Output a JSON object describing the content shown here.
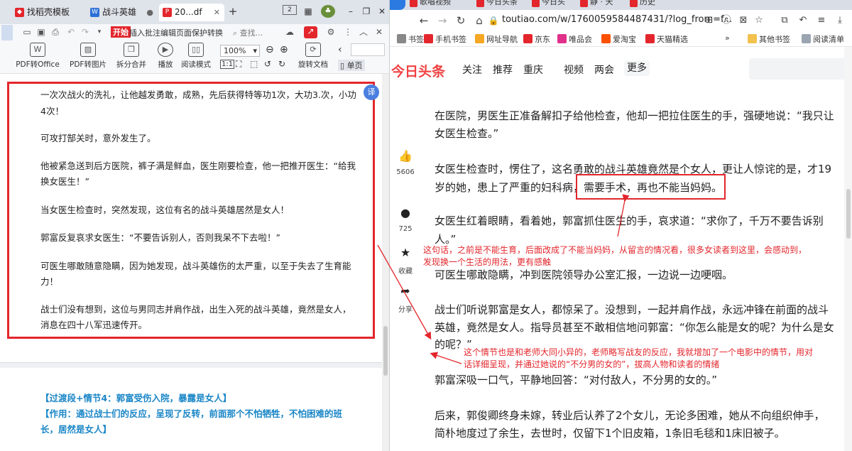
{
  "wps": {
    "tabs": [
      {
        "label": "找稻壳模板",
        "icon": "docer-icon",
        "color": "#e3262c"
      },
      {
        "label": "战斗英雄",
        "icon": "word-doc-icon",
        "color": "#2b6fd6"
      },
      {
        "label": "20...df",
        "icon": "pdf-icon",
        "color": "#e3262c"
      }
    ],
    "new_tab": "+",
    "window_controls": {
      "minimize": "–",
      "restore": "❐",
      "close": "✕"
    },
    "menu": {
      "start": "开始",
      "items": [
        "插入",
        "批注",
        "编辑",
        "页面",
        "保护",
        "转换"
      ],
      "search": "查找..."
    },
    "ribbon": {
      "pdf_to_office": "PDF转Office",
      "pdf_to_image": "PDF转图片",
      "split_merge": "拆分合并",
      "play": "播放",
      "read_mode": "阅读模式",
      "zoom": "100%",
      "rotate": "旋转文档",
      "single_page": "单页"
    },
    "doc_lines": [
      "一次次战火的洗礼，让他越发勇敢，成熟，先后获得特等功1次，大功3.次，小功",
      "4次！",
      "可攻打郜关时，意外发生了。",
      "他被紧急送到后方医院，裤子满是鲜血，医生刚要检查，他一把推开医生：“给我",
      "换女医生！”",
      "当女医生检查时，突然发现，这位有名的战斗英雄居然是女人！",
      "郭富反复哀求女医生：“不要告诉别人，否则我呆不下去啦！”",
      "可医生哪敢随意隐瞒，因为她发现，战斗英雄伤的太严重，以至于失去了生育能",
      "力！",
      "战士们没有想到，这位与男同志并肩作战，出生入死的战斗英雄，竟然是女人，",
      "消息在四十八军迅速传开。"
    ],
    "cyan_lines": [
      "【过渡段+情节4：郭富受伤入院，暴露是女人】",
      "【作用：通过战士们的反应，呈现了反转，前面那个不怕牺牲，不怕困难的班",
      "长，居然是女人】"
    ]
  },
  "browser": {
    "tabs": [
      "歌唱视频",
      "今日头条",
      "今日头",
      "静 · 天",
      "历史"
    ],
    "url": "toutiao.com/w/1760059584487431/?log_from=f...",
    "bookmarks": [
      {
        "label": "书签",
        "color": "#888888"
      },
      {
        "label": "手机书签",
        "color": "#e3262c"
      },
      {
        "label": "网址导航",
        "color": "#f5a623"
      },
      {
        "label": "京东",
        "color": "#e3262c"
      },
      {
        "label": "唯品会",
        "color": "#e0308a"
      },
      {
        "label": "爱淘宝",
        "color": "#ff5000"
      },
      {
        "label": "天猫精选",
        "color": "#e3262c"
      }
    ],
    "bookmarks_right": [
      "其他书签",
      "阅读清单"
    ],
    "more_symbol": "»"
  },
  "toutiao": {
    "logo": "今日头条",
    "nav": [
      "关注",
      "推荐",
      "重庆",
      "视频",
      "两会",
      "更多"
    ],
    "side": {
      "likes": "5606",
      "comments": "725",
      "collect": "收藏",
      "share": "分享"
    },
    "article_lines": [
      "在医院，男医生正准备解扣子给他检查，他却一把拉住医生的手，强硬地说：“我只让",
      "女医生检查。”",
      "女医生检查时，愣住了，这名勇敢的战斗英雄竟然是个女人，更让人惊诧的是，才19",
      "岁的她，患上了严重的妇科病，需要手术，再也不能当妈妈。",
      "女医生红着眼睛，看着她，郭富抓住医生的手，哀求道：“求你了，千万不要告诉别",
      "人。”",
      "可医生哪敢隐瞒，冲到医院领导办公室汇报，一边说一边哽咽。",
      "战士们听说郭富是女人，都惊呆了。没想到，一起并肩作战，永远冲锋在前面的战斗",
      "英雄，竟然是女人。指导员甚至不敢相信地问郭富：“你怎么能是女的呢？为什么是女",
      "的呢？”",
      "郭富深吸一口气，平静地回答：“对付敌人，不分男的女的。”",
      "后来，郭俊卿终身未嫁，转业后认养了2个女儿，无论多困难，她从不向组织伸手，",
      "简朴地度过了余生，去世时，仅留下1个旧皮箱，1条旧毛毯和1床旧被子。"
    ],
    "annotations": [
      "这句话，之前是不能生育，后面改成了不能当妈妈，从留言的情况看，很多女读者到这里，会感动到，",
      "发现换一个生活的用法，更有感触",
      "这个情节也是和老师大同小异的，老师略写战友的反应，我就增加了一个电影中的情节，用对",
      "话详细呈现，并通过她说的“不分男的女的”，拔高人物和读者的情绪"
    ]
  },
  "colors": {
    "accent_red": "#e3262c",
    "toutiao_red": "#f04142",
    "cyan": "#1a86c7"
  }
}
